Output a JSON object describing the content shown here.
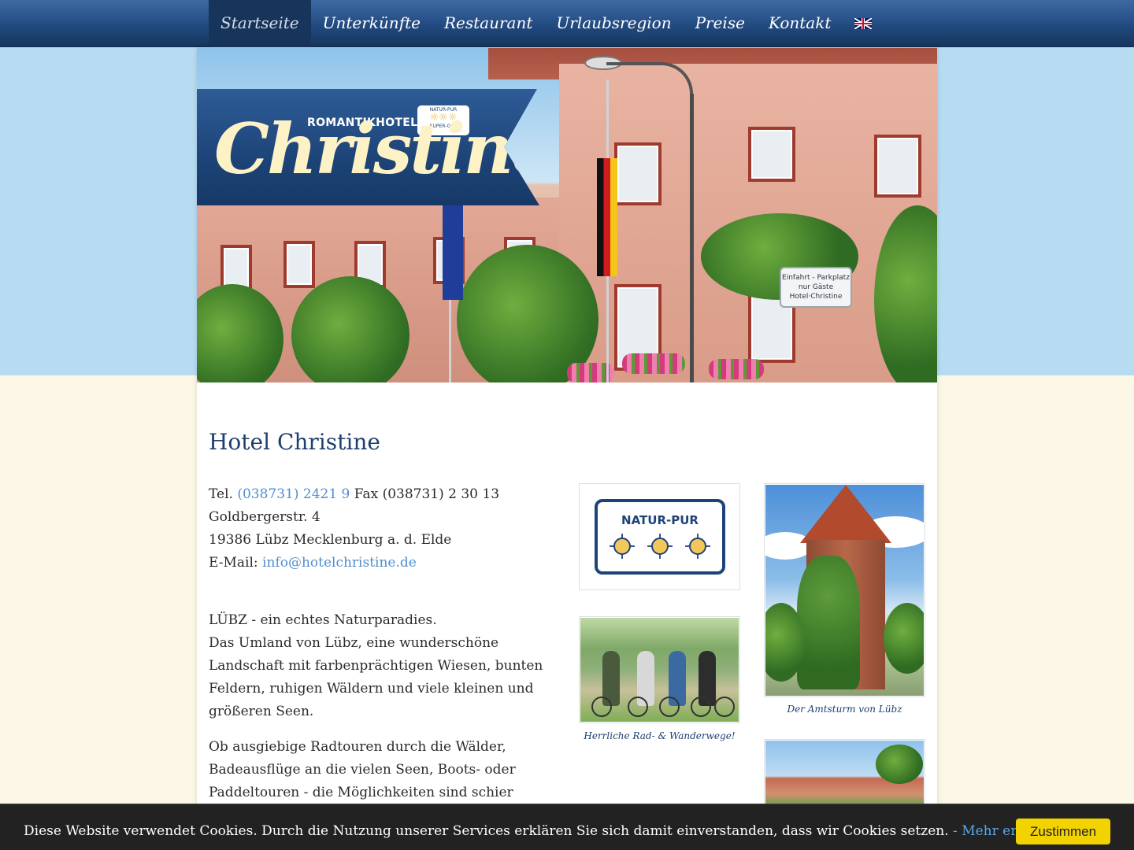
{
  "nav": {
    "items": [
      {
        "label": "Startseite",
        "active": true
      },
      {
        "label": "Unterkünfte"
      },
      {
        "label": "Restaurant"
      },
      {
        "label": "Urlaubsregion"
      },
      {
        "label": "Preise"
      },
      {
        "label": "Kontakt"
      }
    ],
    "language_icon": "uk-flag-icon"
  },
  "header": {
    "logo_subtitle": "ROMANTIKHOTEL",
    "logo_name": "Christine",
    "badge_top": "NATUR-PUR",
    "badge_bottom": "SUPER-GUT",
    "parking_sign": "Einfahrt - Parkplatz nur Gäste Hotel·Christine"
  },
  "main": {
    "title": "Hotel Christine",
    "contact": {
      "tel_label": "Tel.",
      "tel": "(038731) 2421 9",
      "fax": "Fax (038731) 2 30 13",
      "street": "Goldbergerstr. 4",
      "city": "19386 Lübz Mecklenburg a. d. Elde",
      "email_label": "E-Mail:",
      "email": "info@hotelchristine.de"
    },
    "intro": {
      "p1_line1": "LÜBZ - ein echtes Naturparadies.",
      "p1_line2": "Das Umland von Lübz, eine wunderschöne Landschaft mit farbenprächtigen Wiesen, bunten Feldern, ruhigen Wäldern und viele kleinen und größeren Seen.",
      "p2": "Ob ausgiebige Radtouren durch die Wälder, Badeausflüge an die vielen Seen, Boots- oder Paddeltouren - die Möglichkeiten sind schier"
    },
    "natur_pur_label": "NATUR-PUR",
    "bike_caption": "Herrliche Rad- & Wanderwege!",
    "tower_caption": "Der Amtsturm von Lübz"
  },
  "cookie": {
    "text": "Diese Website verwendet Cookies. Durch die Nutzung unserer Services erklären Sie sich damit einverstanden, dass wir Cookies setzen.",
    "link": "- Mehr erfahren",
    "button": "Zustimmen"
  },
  "colors": {
    "nav": "#224a80",
    "title": "#1d3f6e",
    "link": "#4f8fcf",
    "cookie_button": "#f2d200"
  }
}
